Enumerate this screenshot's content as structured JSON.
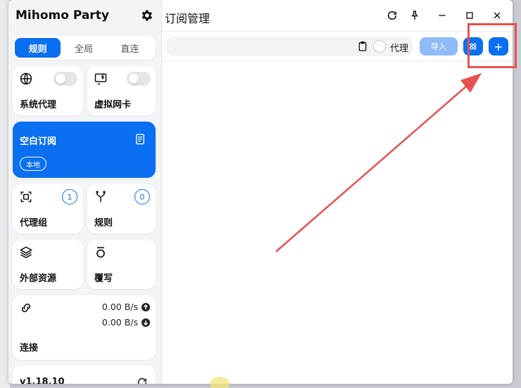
{
  "app": {
    "brand": "Mihomo Party"
  },
  "sidebar": {
    "mode_tabs": [
      {
        "label": "规则",
        "active": true
      },
      {
        "label": "全局",
        "active": false
      },
      {
        "label": "直连",
        "active": false
      }
    ],
    "system_proxy": {
      "label": "系统代理",
      "enabled": false
    },
    "virtual_nic": {
      "label": "虚拟网卡",
      "enabled": false
    },
    "subscription": {
      "label": "空白订阅",
      "badge": "本地"
    },
    "proxy_groups": {
      "label": "代理组",
      "count": "1"
    },
    "rules": {
      "label": "规则",
      "count": "0"
    },
    "external_resources": {
      "label": "外部资源"
    },
    "override": {
      "label": "覆写"
    },
    "connections": {
      "label": "连接",
      "upload": "0.00 B/s",
      "download": "0.00 B/s"
    },
    "version": "v1.18.10"
  },
  "main": {
    "title": "订阅管理",
    "url_input": {
      "value": "",
      "placeholder": ""
    },
    "proxy_label": "代理",
    "import_label": "导入",
    "add_label": "+"
  },
  "colors": {
    "accent": "#0a6ff0",
    "accent_disabled": "#8fbcf8",
    "annotation": "#e8514f"
  }
}
